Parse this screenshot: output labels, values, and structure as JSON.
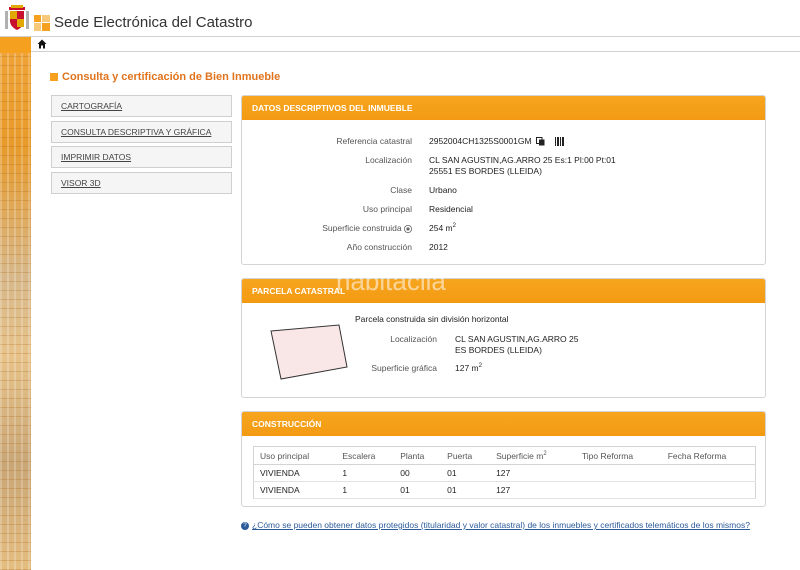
{
  "header": {
    "site_title": "Sede Electrónica del Catastro"
  },
  "page_title": "Consulta y certificación de Bien Inmueble",
  "menu": [
    {
      "label": "CARTOGRAFÍA"
    },
    {
      "label": "CONSULTA DESCRIPTIVA Y GRÁFICA"
    },
    {
      "label": "IMPRIMIR DATOS"
    },
    {
      "label": "VISOR 3D"
    }
  ],
  "datos": {
    "title": "DATOS DESCRIPTIVOS DEL INMUEBLE",
    "referencia_label": "Referencia catastral",
    "referencia_value": "2952004CH1325S0001GM",
    "localizacion_label": "Localización",
    "localizacion_line1": "CL SAN AGUSTIN,AG.ARRO 25 Es:1 Pl:00 Pt:01",
    "localizacion_line2": "25551 ES BORDES (LLEIDA)",
    "clase_label": "Clase",
    "clase_value": "Urbano",
    "uso_label": "Uso principal",
    "uso_value": "Residencial",
    "superficie_label": "Superficie construida",
    "superficie_value": "254 m",
    "superficie_sup": "2",
    "anio_label": "Año construcción",
    "anio_value": "2012"
  },
  "parcela": {
    "title": "PARCELA CATASTRAL",
    "description": "Parcela construida sin división horizontal",
    "localizacion_label": "Localización",
    "localizacion_line1": "CL SAN AGUSTIN,AG.ARRO 25",
    "localizacion_line2": "ES BORDES (LLEIDA)",
    "superficie_label": "Superficie gráfica",
    "superficie_value": "127 m",
    "superficie_sup": "2"
  },
  "construccion": {
    "title": "CONSTRUCCIÓN",
    "headers": [
      "Uso principal",
      "Escalera",
      "Planta",
      "Puerta",
      "Superficie m",
      "Tipo Reforma",
      "Fecha Reforma"
    ],
    "sup_header_exp": "2",
    "rows": [
      [
        "VIVIENDA",
        "1",
        "00",
        "01",
        "127",
        "",
        ""
      ],
      [
        "VIVIENDA",
        "1",
        "01",
        "01",
        "127",
        "",
        ""
      ]
    ]
  },
  "watermark": "habitaclia",
  "footer_link": "¿Cómo se pueden obtener datos protegidos (titularidad y valor catastral) de los inmuebles y certificados telemáticos de los mismos?",
  "colors": {
    "accent": "#f5a01e",
    "title_orange": "#e0731c",
    "link_blue": "#2b5a9a"
  }
}
